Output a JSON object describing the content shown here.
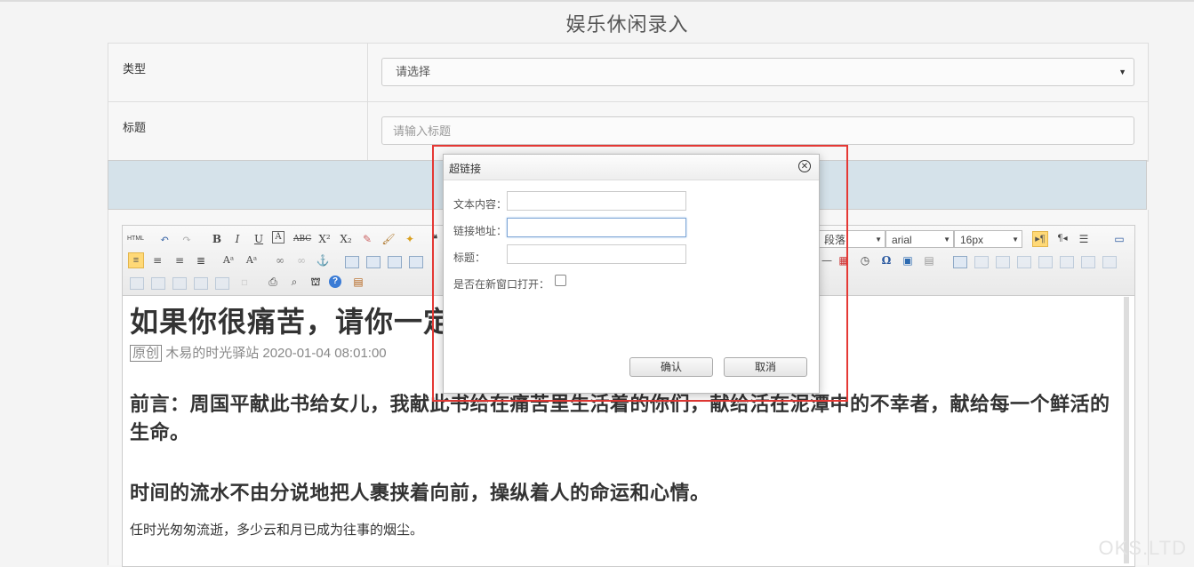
{
  "page_title": "娱乐休闲录入",
  "form": {
    "type_label": "类型",
    "type_select_value": "请选择",
    "title_label": "标题",
    "title_placeholder": "请输入标题"
  },
  "toolbar": {
    "paragraph_select": "段落",
    "font_select": "arial",
    "size_select": "16px"
  },
  "article": {
    "heading": "如果你很痛苦，请你一定",
    "meta_tag": "原创",
    "meta_author_date": "木易的时光驿站 2020-01-04 08:01:00",
    "preface": "前言：周国平献此书给女儿，我献此书给在痛苦里生活着的你们，献给活在泥潭中的不幸者，献给每一个鲜活的生命。",
    "subheading": "时间的流水不由分说地把人裹挟着向前，操纵着人的命运和心情。",
    "paragraph": "任时光匆匆流逝，多少云和月已成为往事的烟尘。"
  },
  "dialog": {
    "title": "超链接",
    "text_label": "文本内容：",
    "url_label": "链接地址：",
    "title_label": "标题：",
    "new_window_label": "是否在新窗口打开：",
    "new_window_checked": false,
    "confirm_label": "确认",
    "cancel_label": "取消"
  },
  "watermark": "OKS.LTD",
  "colors": {
    "highlight_frame": "#e53935",
    "band": "#d5e2ea"
  }
}
